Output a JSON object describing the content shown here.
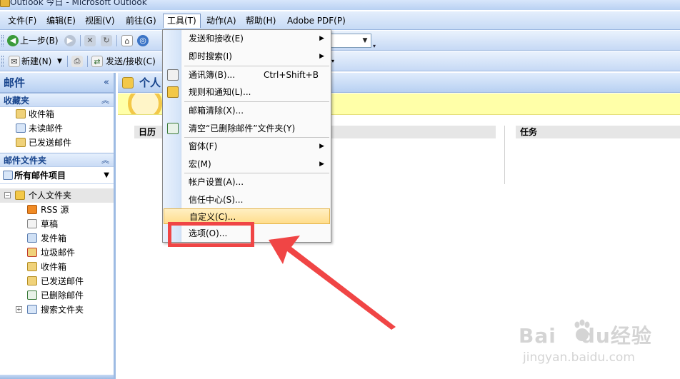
{
  "window": {
    "title": "Outlook 今日 - Microsoft Outlook"
  },
  "menu": [
    "文件(F)",
    "编辑(E)",
    "视图(V)",
    "前往(G)",
    "工具(T)",
    "动作(A)",
    "帮助(H)",
    "Adobe PDF(P)"
  ],
  "toolbar1": {
    "back_label": "上一步(B)"
  },
  "toolbar2": {
    "new_label": "新建(N)",
    "send_receive_label": "发送/接收(C)"
  },
  "nav": {
    "title": "邮件",
    "collapse": "«",
    "favorites_title": "收藏夹",
    "favorites": [
      "收件箱",
      "未读邮件",
      "已发送邮件"
    ],
    "mail_folders_title": "邮件文件夹",
    "all_mail": "所有邮件项目",
    "root_folder": "个人文件夹",
    "folders": [
      "RSS 源",
      "草稿",
      "发件箱",
      "垃圾邮件",
      "收件箱",
      "已发送邮件",
      "已删除邮件"
    ],
    "search_folder": "搜索文件夹"
  },
  "content": {
    "title": "个人",
    "calendar_label": "日历",
    "tasks_label": "任务"
  },
  "dropdown": {
    "items": [
      {
        "label": "发送和接收(E)",
        "shortcut": "",
        "submenu": true
      },
      {
        "label": "即时搜索(I)",
        "shortcut": "",
        "submenu": true
      },
      {
        "label": "通讯簿(B)...",
        "shortcut": "Ctrl+Shift+B",
        "submenu": false
      },
      {
        "label": "规则和通知(L)...",
        "shortcut": "",
        "submenu": false
      },
      {
        "label": "邮箱清除(X)...",
        "shortcut": "",
        "submenu": false
      },
      {
        "label": "清空“已删除邮件”文件夹(Y)",
        "shortcut": "",
        "submenu": false
      },
      {
        "label": "窗体(F)",
        "shortcut": "",
        "submenu": true
      },
      {
        "label": "宏(M)",
        "shortcut": "",
        "submenu": true
      },
      {
        "label": "帐户设置(A)...",
        "shortcut": "",
        "submenu": false
      },
      {
        "label": "信任中心(S)...",
        "shortcut": "",
        "submenu": false
      },
      {
        "label": "自定义(C)...",
        "shortcut": "",
        "submenu": false
      },
      {
        "label": "选项(O)...",
        "shortcut": "",
        "submenu": false
      }
    ]
  },
  "watermark": {
    "brand_a": "Bai",
    "brand_b": "du",
    "brand_c": "经验",
    "url": "jingyan.baidu.com"
  },
  "colors": {
    "highlight": "#ffdd8c",
    "annotation": "#f04545",
    "nav_title": "#15428b"
  }
}
